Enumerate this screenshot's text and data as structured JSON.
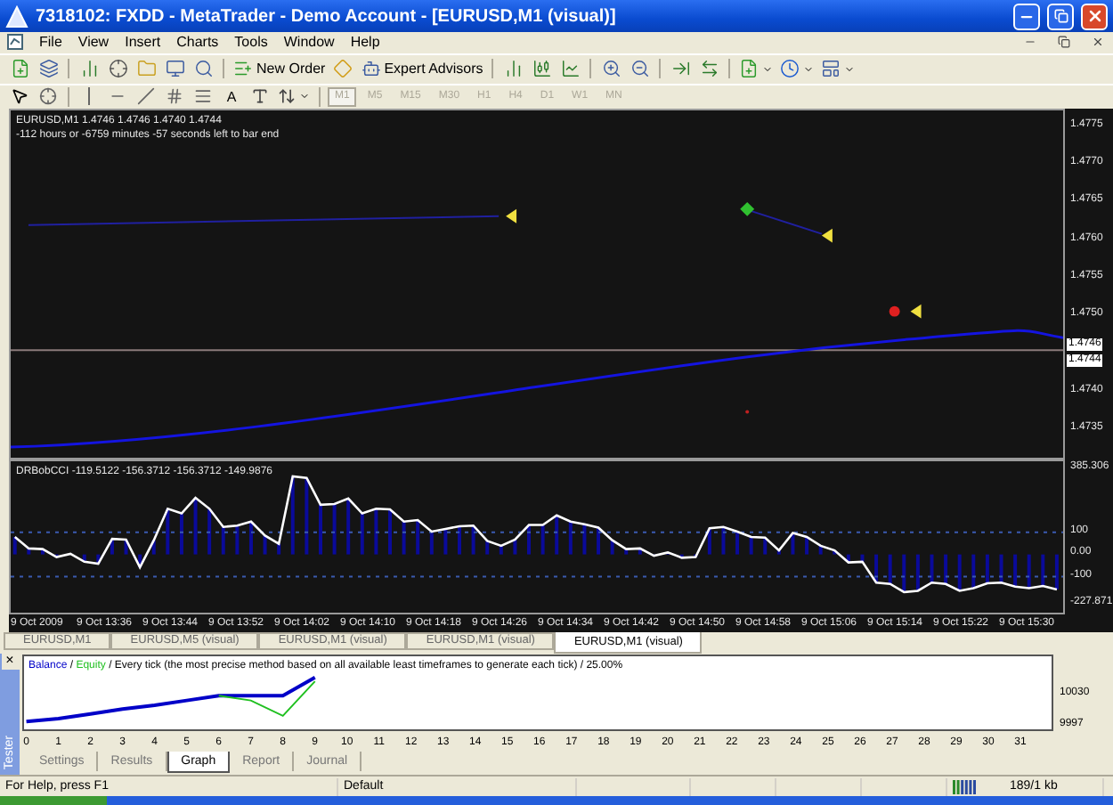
{
  "window": {
    "title": "7318102: FXDD - MetaTrader - Demo Account - [EURUSD,M1 (visual)]"
  },
  "menu": [
    "File",
    "View",
    "Insert",
    "Charts",
    "Tools",
    "Window",
    "Help"
  ],
  "toolbar": {
    "new_order": "New Order",
    "expert_advisors": "Expert Advisors"
  },
  "drawing_toolbar": {
    "text_tool": "A",
    "timeframes": [
      {
        "label": "M1",
        "selected": true
      },
      {
        "label": "M5",
        "selected": false
      },
      {
        "label": "M15",
        "selected": false
      },
      {
        "label": "M30",
        "selected": false
      },
      {
        "label": "H1",
        "selected": false
      },
      {
        "label": "H4",
        "selected": false
      },
      {
        "label": "D1",
        "selected": false
      },
      {
        "label": "W1",
        "selected": false
      },
      {
        "label": "MN",
        "selected": false
      }
    ]
  },
  "chart": {
    "header": [
      "EURUSD,M1  1.4746 1.4746 1.4740 1.4744",
      "-112 hours or -6759 minutes -57 seconds left to bar end"
    ],
    "price_axis": [
      "1.4775",
      "1.4770",
      "1.4765",
      "1.4760",
      "1.4755",
      "1.4750",
      "1.4740",
      "1.4735"
    ],
    "price_markers": [
      "1.4746",
      "1.4744"
    ],
    "indicator": {
      "label": "DRBobCCI -119.5122 -156.3712 -156.3712 -149.9876",
      "chart_data": {
        "type": "line",
        "ylim": [
          -262.5,
          420
        ],
        "yticks": [
          {
            "value": 385.306,
            "label": "385.306"
          },
          {
            "value": 100,
            "label": "100"
          },
          {
            "value": 0,
            "label": "0.00"
          },
          {
            "value": -100,
            "label": "-100"
          },
          {
            "value": -227.871,
            "label": "-227.871"
          }
        ],
        "series": [
          {
            "color": "#ffffff",
            "values": [
              79,
              27,
              24,
              -12,
              3,
              -33,
              -42,
              70,
              67,
              -58,
              64,
              206,
              185,
              255,
              206,
              124,
              130,
              148,
              85,
              48,
              352,
              345,
              224,
              227,
              252,
              185,
              206,
              203,
              148,
              155,
              103,
              115,
              127,
              130,
              61,
              39,
              67,
              133,
              133,
              176,
              148,
              136,
              121,
              64,
              24,
              27,
              -6,
              9,
              -15,
              -12,
              118,
              124,
              103,
              79,
              76,
              18,
              97,
              79,
              39,
              18,
              -36,
              -33,
              -127,
              -133,
              -170,
              -164,
              -127,
              -133,
              -164,
              -152,
              -130,
              -127,
              -145,
              -152,
              -142,
              -158
            ]
          }
        ]
      }
    },
    "time_axis": [
      "9 Oct 2009",
      "9 Oct 13:36",
      "9 Oct 13:44",
      "9 Oct 13:52",
      "9 Oct 14:02",
      "9 Oct 14:10",
      "9 Oct 14:18",
      "9 Oct 14:26",
      "9 Oct 14:34",
      "9 Oct 14:42",
      "9 Oct 14:50",
      "9 Oct 14:58",
      "9 Oct 15:06",
      "9 Oct 15:14",
      "9 Oct 15:22",
      "9 Oct 15:30"
    ]
  },
  "chart_tabs": [
    {
      "label": "EURUSD,M1",
      "selected": false
    },
    {
      "label": "EURUSD,M5 (visual)",
      "selected": false
    },
    {
      "label": "EURUSD,M1 (visual)",
      "selected": false
    },
    {
      "label": "EURUSD,M1 (visual)",
      "selected": false
    },
    {
      "label": "EURUSD,M1 (visual)",
      "selected": true
    }
  ],
  "tester": {
    "title": "Tester",
    "close_glyph": "×",
    "legend_separator": "/",
    "legend_text": "/ Every tick (the most precise method based on all available least timeframes to generate each tick) / 25.00%",
    "chart_data": {
      "type": "line",
      "x": [
        0,
        1,
        2,
        3,
        4,
        5,
        6,
        7,
        8,
        9
      ],
      "xlim": [
        -0.1,
        32
      ],
      "ylim": [
        9989,
        10067
      ],
      "xticks": [
        {
          "value": 0,
          "label": "0"
        },
        {
          "value": 1,
          "label": "1"
        },
        {
          "value": 2,
          "label": "2"
        },
        {
          "value": 3,
          "label": "3"
        },
        {
          "value": 4,
          "label": "4"
        },
        {
          "value": 5,
          "label": "5"
        },
        {
          "value": 6,
          "label": "6"
        },
        {
          "value": 7,
          "label": "7"
        },
        {
          "value": 8,
          "label": "8"
        },
        {
          "value": 9,
          "label": "9"
        },
        {
          "value": 10,
          "label": "10"
        },
        {
          "value": 11,
          "label": "11"
        },
        {
          "value": 12,
          "label": "12"
        },
        {
          "value": 13,
          "label": "13"
        },
        {
          "value": 14,
          "label": "14"
        },
        {
          "value": 15,
          "label": "15"
        },
        {
          "value": 16,
          "label": "16"
        },
        {
          "value": 17,
          "label": "17"
        },
        {
          "value": 18,
          "label": "18"
        },
        {
          "value": 19,
          "label": "19"
        },
        {
          "value": 20,
          "label": "20"
        },
        {
          "value": 21,
          "label": "21"
        },
        {
          "value": 22,
          "label": "22"
        },
        {
          "value": 23,
          "label": "23"
        },
        {
          "value": 24,
          "label": "24"
        },
        {
          "value": 25,
          "label": "25"
        },
        {
          "value": 26,
          "label": "26"
        },
        {
          "value": 27,
          "label": "27"
        },
        {
          "value": 28,
          "label": "28"
        },
        {
          "value": 29,
          "label": "29"
        },
        {
          "value": 30,
          "label": "30"
        },
        {
          "value": 31,
          "label": "31"
        }
      ],
      "yticks": [
        {
          "value": 9997,
          "label": "9997"
        },
        {
          "value": 10030,
          "label": "10030"
        }
      ],
      "series": [
        {
          "name": "Balance",
          "color": "#0000c8",
          "values": [
            9998,
            10001,
            10006,
            10011,
            10015,
            10020,
            10025,
            10025,
            10025,
            10044
          ]
        },
        {
          "name": "Equity",
          "color": "#20c020",
          "values": [
            null,
            null,
            null,
            null,
            null,
            null,
            10025,
            10020,
            10004,
            10040
          ]
        }
      ]
    },
    "tabs": [
      {
        "label": "Settings",
        "selected": false
      },
      {
        "label": "Results",
        "selected": false
      },
      {
        "label": "Graph",
        "selected": true
      },
      {
        "label": "Report",
        "selected": false
      },
      {
        "label": "Journal",
        "selected": false
      }
    ]
  },
  "status_bar": [
    "For Help, press F1",
    "Default",
    "189/1 kb"
  ]
}
